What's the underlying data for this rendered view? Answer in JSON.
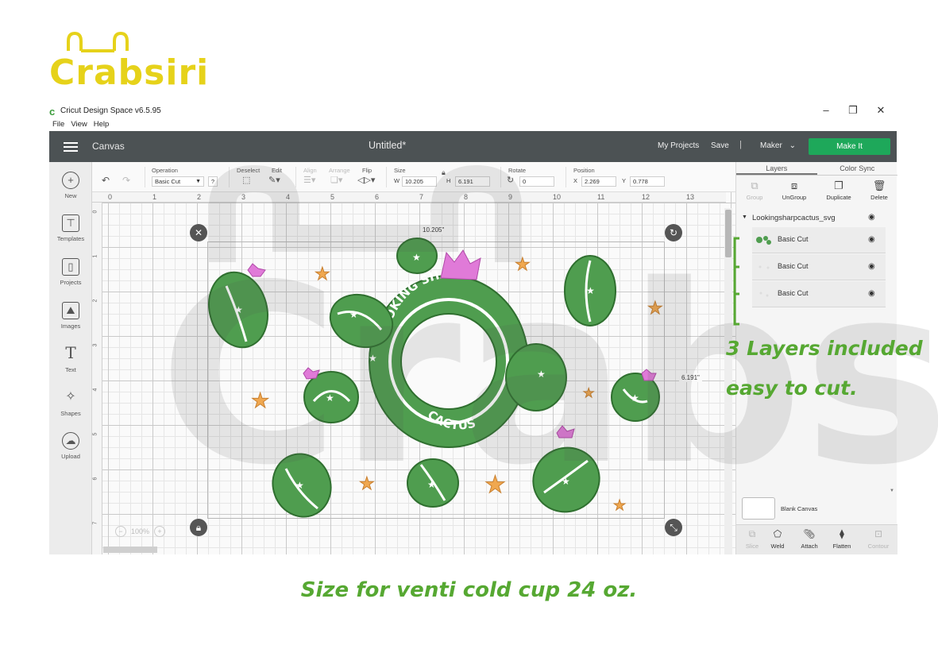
{
  "brand": {
    "name": "Crabsiri",
    "color": "#e6d21a"
  },
  "window": {
    "title": "Cricut Design Space  v6.5.95",
    "icon": "cricut-c-icon",
    "controls": [
      "–",
      "❐",
      "✕"
    ],
    "menu": [
      "File",
      "View",
      "Help"
    ]
  },
  "header": {
    "section": "Canvas",
    "doc_title": "Untitled*",
    "my_projects": "My Projects",
    "save": "Save",
    "separator": "|",
    "machine": "Maker",
    "make_it": "Make It",
    "colors": {
      "bar": "#4c5254",
      "make_it": "#1ea85a"
    }
  },
  "left_tools": [
    {
      "label": "New",
      "icon": "plus-icon"
    },
    {
      "label": "Templates",
      "icon": "shirt-icon"
    },
    {
      "label": "Projects",
      "icon": "bookmark-icon"
    },
    {
      "label": "Images",
      "icon": "image-icon"
    },
    {
      "label": "Text",
      "icon": "text-icon"
    },
    {
      "label": "Shapes",
      "icon": "shapes-icon"
    },
    {
      "label": "Upload",
      "icon": "upload-cloud-icon"
    }
  ],
  "options": {
    "operation_label": "Operation",
    "operation_value": "Basic Cut",
    "help": "?",
    "deselect_label": "Deselect",
    "edit_label": "Edit",
    "align_label": "Align",
    "arrange_label": "Arrange",
    "flip_label": "Flip",
    "size_label": "Size",
    "w_label": "W",
    "w_value": "10.205",
    "h_label": "H",
    "h_value": "6.191",
    "rotate_label": "Rotate",
    "rotate_value": "0",
    "position_label": "Position",
    "x_label": "X",
    "x_value": "2.269",
    "y_label": "Y",
    "y_value": "0.778"
  },
  "canvas": {
    "ruler_top": [
      "0",
      "1",
      "2",
      "3",
      "4",
      "5",
      "6",
      "7",
      "8",
      "9",
      "10",
      "11",
      "12",
      "13"
    ],
    "ruler_left": [
      "0",
      "1",
      "2",
      "3",
      "4",
      "5",
      "6",
      "7"
    ],
    "width_tag": "10.205\"",
    "height_tag": "6.191\"",
    "zoom": "100%",
    "artwork_text_top": "LOOKING SHARP",
    "artwork_text_bottom": "CACTUS",
    "watermark": "Crabsiri",
    "cactus_color": "#4f9d4f",
    "star_color": "#f0a850",
    "flower_color": "#e07ad8"
  },
  "layers_panel": {
    "tabs": [
      "Layers",
      "Color Sync"
    ],
    "actions": [
      {
        "label": "Group",
        "icon": "group-icon",
        "enabled": false
      },
      {
        "label": "UnGroup",
        "icon": "ungroup-icon",
        "enabled": true
      },
      {
        "label": "Duplicate",
        "icon": "duplicate-icon",
        "enabled": true
      },
      {
        "label": "Delete",
        "icon": "trash-icon",
        "enabled": true
      }
    ],
    "group_name": "Lookingsharpcactus_svg",
    "layers": [
      "Basic Cut",
      "Basic Cut",
      "Basic Cut"
    ],
    "blank_canvas": "Blank Canvas",
    "bottom_tools": [
      {
        "label": "Slice",
        "icon": "slice-icon",
        "enabled": false
      },
      {
        "label": "Weld",
        "icon": "weld-icon",
        "enabled": true
      },
      {
        "label": "Attach",
        "icon": "paperclip-icon",
        "enabled": true
      },
      {
        "label": "Flatten",
        "icon": "flatten-icon",
        "enabled": true
      },
      {
        "label": "Contour",
        "icon": "contour-icon",
        "enabled": false
      }
    ]
  },
  "annotation": {
    "line1": "3 Layers included",
    "line2": "easy to cut.",
    "color": "#56a832"
  },
  "caption": "Size for venti cold cup 24 oz."
}
